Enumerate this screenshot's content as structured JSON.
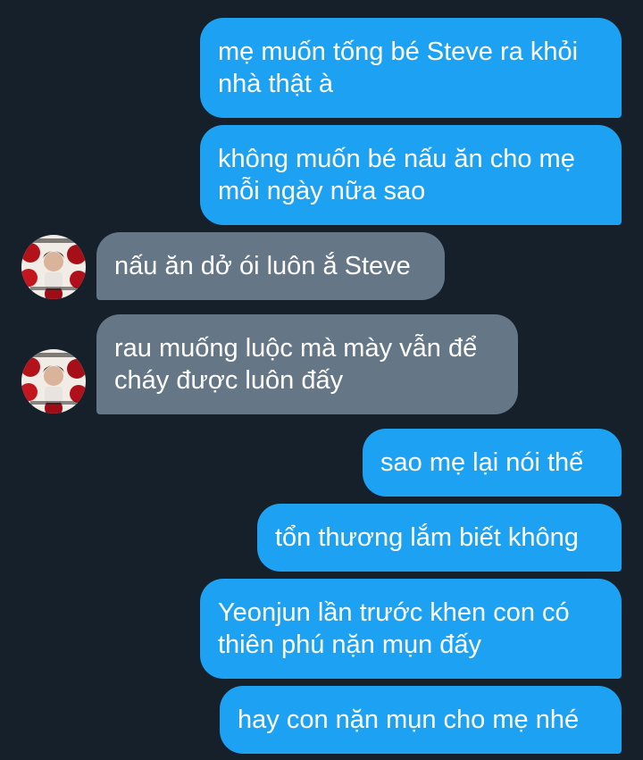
{
  "colors": {
    "background": "#15202b",
    "outgoing_bubble": "#1da1f2",
    "incoming_bubble": "#657786",
    "text": "#ffffff"
  },
  "messages": [
    {
      "direction": "outgoing",
      "text": "mẹ muốn tống bé Steve ra khỏi\nnhà thật à"
    },
    {
      "direction": "outgoing",
      "text": "không muốn bé nấu ăn cho mẹ\nmỗi ngày nữa sao"
    },
    {
      "direction": "incoming",
      "text": "nấu ăn dở ói luôn ắ Steve"
    },
    {
      "direction": "incoming",
      "text": "rau muống luộc mà mày vẫn để\ncháy được luôn đấy"
    },
    {
      "direction": "outgoing",
      "text": "sao mẹ lại nói thế"
    },
    {
      "direction": "outgoing",
      "text": "tổn thương lắm biết không"
    },
    {
      "direction": "outgoing",
      "text": "Yeonjun lần trước khen con có\nthiên phú nặn mụn đấy"
    },
    {
      "direction": "outgoing",
      "text": "hay con nặn mụn cho mẹ nhé"
    }
  ]
}
